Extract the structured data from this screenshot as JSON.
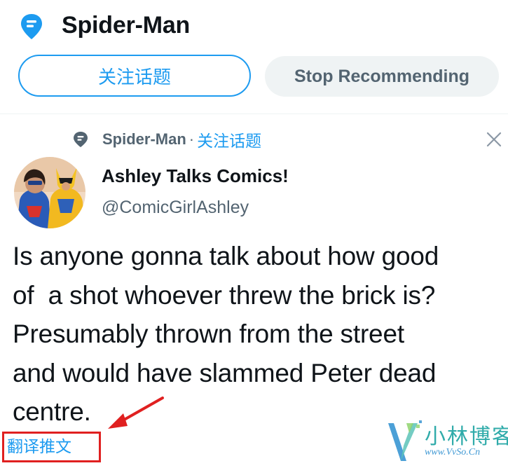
{
  "header": {
    "topic_title": "Spider-Man",
    "follow_label": "关注话题",
    "stop_label": "Stop Recommending"
  },
  "tweet": {
    "context_topic": "Spider-Man",
    "context_separator": "·",
    "context_follow_label": "关注话题",
    "author": {
      "display_name": "Ashley Talks Comics!",
      "handle": "@ComicGirlAshley"
    },
    "text_lines": [
      "Is anyone gonna talk about how good",
      "of  a shot whoever threw the brick is?",
      "Presumably thrown from the street",
      "and would have slammed Peter dead",
      "centre."
    ],
    "translate_label": "翻译推文"
  },
  "watermark": {
    "title": "小林博客",
    "subtitle": "www.VvSo.Cn"
  },
  "colors": {
    "accent": "#1d9bf0",
    "secondary_text": "#536471",
    "button_gray": "#eff3f4",
    "annotation_red": "#e02020"
  },
  "icons": {
    "topic": "topic-bubble-icon",
    "close": "close-icon",
    "arrow": "annotation-arrow"
  }
}
